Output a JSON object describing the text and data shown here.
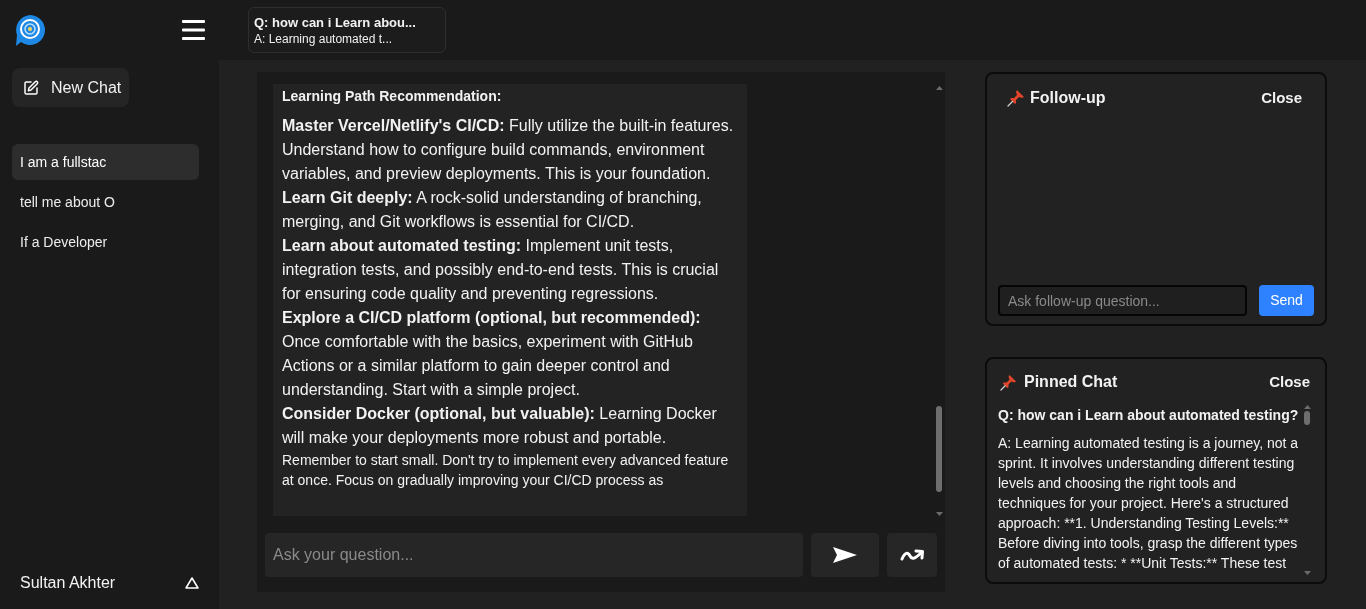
{
  "top_bar": {
    "pinned_preview": {
      "question": "Q: how can i Learn abou...",
      "answer": "A: Learning automated t..."
    }
  },
  "sidebar": {
    "new_chat": "New Chat",
    "history": [
      {
        "label": "I am a fullstac",
        "selected": true
      },
      {
        "label": "tell me about O",
        "selected": false
      },
      {
        "label": "If a Developer",
        "selected": false
      }
    ],
    "user": "Sultan Akhter"
  },
  "chat": {
    "message": {
      "heading": "Learning Path Recommendation:",
      "paragraphs": [
        {
          "kind": "item",
          "text": "**Master Vercel/Netlify's CI/CD:** Fully utilize the built-in features. Understand how to configure build commands, environment variables, and preview deployments. This is your foundation."
        },
        {
          "kind": "item",
          "text": "**Learn Git deeply:** A rock-solid understanding of branching, merging, and Git workflows is essential for CI/CD."
        },
        {
          "kind": "item",
          "text": "**Learn about automated testing:** Implement unit tests, integration tests, and possibly end-to-end tests. This is crucial for ensuring code quality and preventing regressions."
        },
        {
          "kind": "item",
          "text": "**Explore a CI/CD platform (optional, but recommended):** Once comfortable with the basics, experiment with GitHub Actions or a similar platform to gain deeper control and understanding. Start with a simple project."
        },
        {
          "kind": "item",
          "text": "**Consider Docker (optional, but valuable):** Learning Docker will make your deployments more robust and portable."
        },
        {
          "kind": "note",
          "text": "Remember to start small. Don't try to implement every advanced feature at once. Focus on gradually improving your CI/CD process as"
        }
      ]
    },
    "input": {
      "placeholder": "Ask your question..."
    }
  },
  "follow_up": {
    "title": "Follow-up",
    "close": "Close",
    "input": {
      "placeholder": "Ask follow-up question..."
    },
    "send": "Send"
  },
  "pinned_chat": {
    "title": "Pinned Chat",
    "close": "Close",
    "question": "Q: how can i Learn about automated testing?",
    "answer": "A: Learning automated testing is a journey, not a sprint. It involves understanding different testing levels and choosing the right tools and techniques for your project. Here's a structured approach: **1. Understanding Testing Levels:** Before diving into tools, grasp the different types of automated tests: * **Unit Tests:** These test"
  }
}
